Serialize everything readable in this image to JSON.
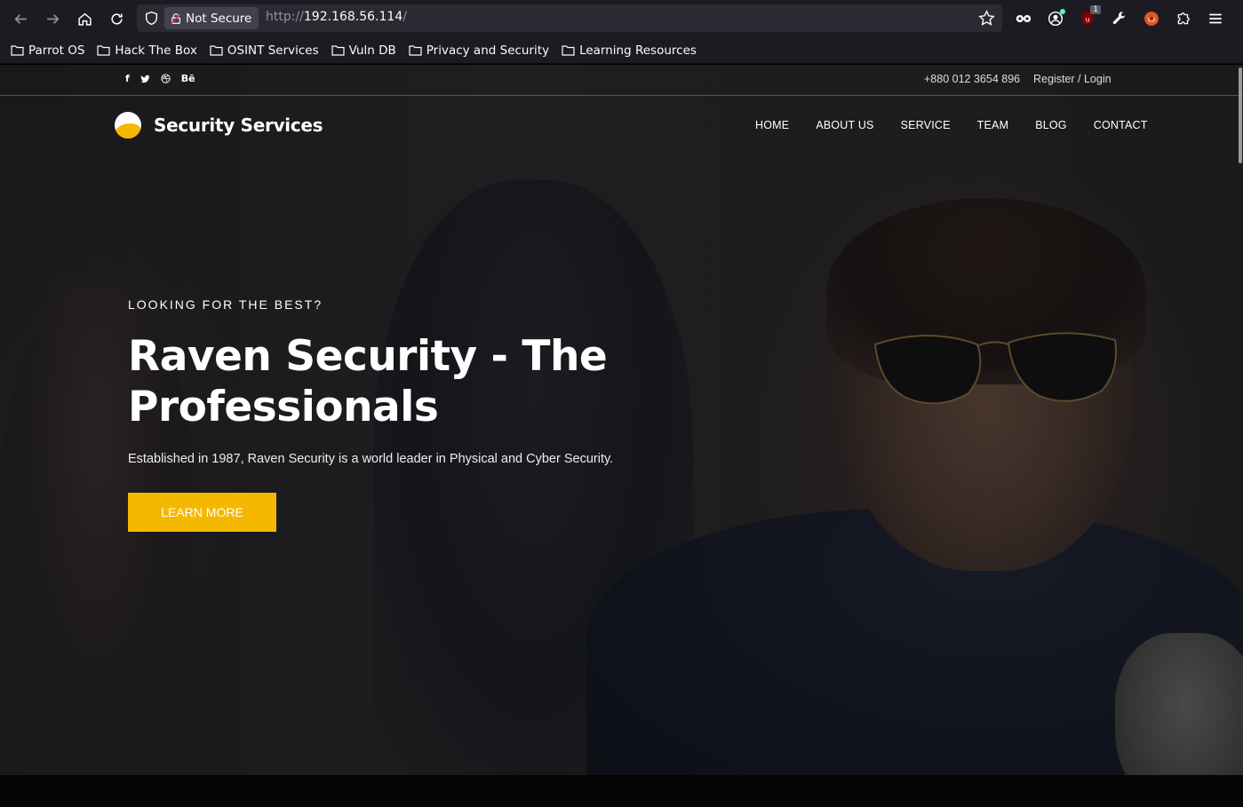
{
  "browser": {
    "security_label": "Not Secure",
    "url_scheme": "http://",
    "url_host": "192.168.56.114",
    "url_path": "/",
    "extension_badge": "1"
  },
  "bookmarks": [
    {
      "label": "Parrot OS"
    },
    {
      "label": "Hack The Box"
    },
    {
      "label": "OSINT Services"
    },
    {
      "label": "Vuln DB"
    },
    {
      "label": "Privacy and Security"
    },
    {
      "label": "Learning Resources"
    }
  ],
  "topbar": {
    "social": [
      "facebook-icon",
      "twitter-icon",
      "dribbble-icon",
      "behance-icon"
    ],
    "behance_text": "Bē",
    "phone": "+880 012 3654 896",
    "auth": "Register / Login"
  },
  "header": {
    "logo_text": "Security Services",
    "nav": [
      "HOME",
      "ABOUT US",
      "SERVICE",
      "TEAM",
      "BLOG",
      "CONTACT"
    ]
  },
  "hero": {
    "eyebrow": "LOOKING FOR THE BEST?",
    "title": "Raven Security - The Professionals",
    "subtitle": "Established in 1987, Raven Security is a world leader in Physical and Cyber Security.",
    "cta": "LEARN MORE"
  },
  "colors": {
    "accent": "#f5b800",
    "browser_bg": "#1c1b22",
    "urlbar_bg": "#2b2a33"
  }
}
